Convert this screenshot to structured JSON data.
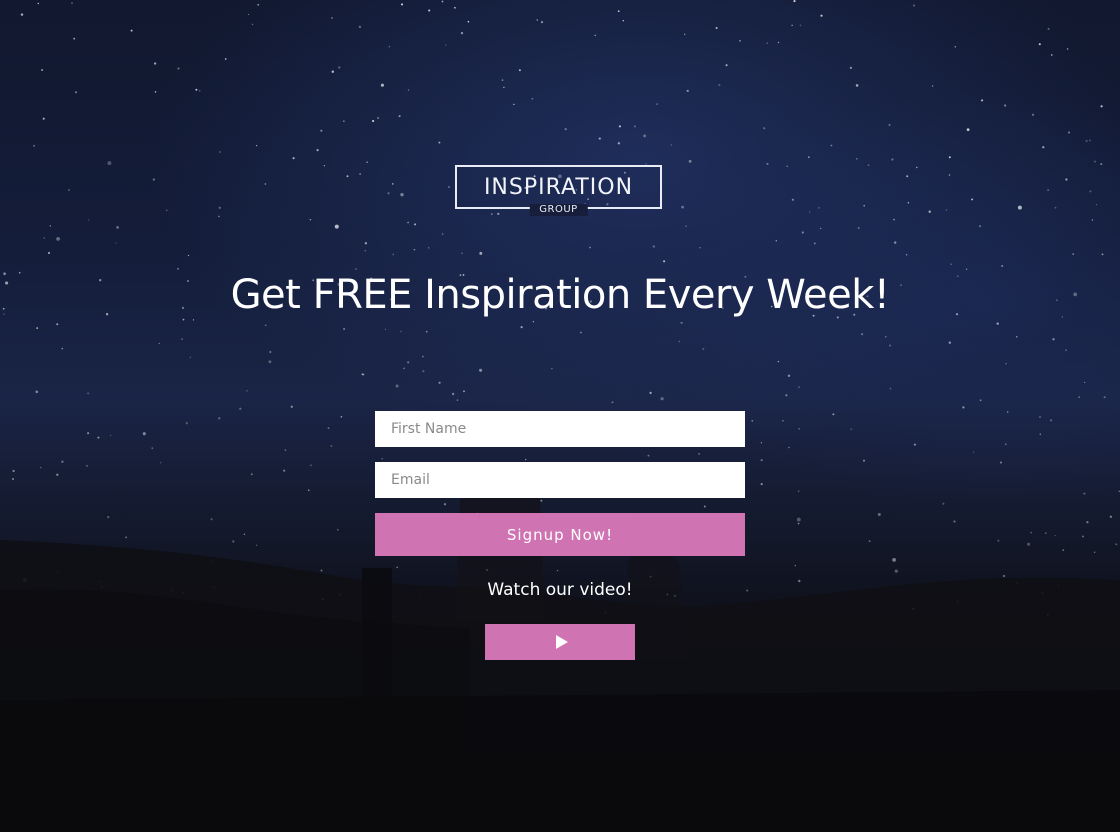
{
  "brand": {
    "name": "INSPIRATION",
    "sub": "GROUP"
  },
  "hero": {
    "headline": "Get FREE Inspiration Every Week!"
  },
  "form": {
    "first_name_placeholder": "First Name",
    "email_placeholder": "Email",
    "signup_label": "Signup Now!"
  },
  "video": {
    "label": "Watch our video!",
    "play_icon": "play-icon"
  },
  "colors": {
    "accent": "#cf73b3",
    "sky": "#141d3a",
    "text": "#ffffff"
  }
}
